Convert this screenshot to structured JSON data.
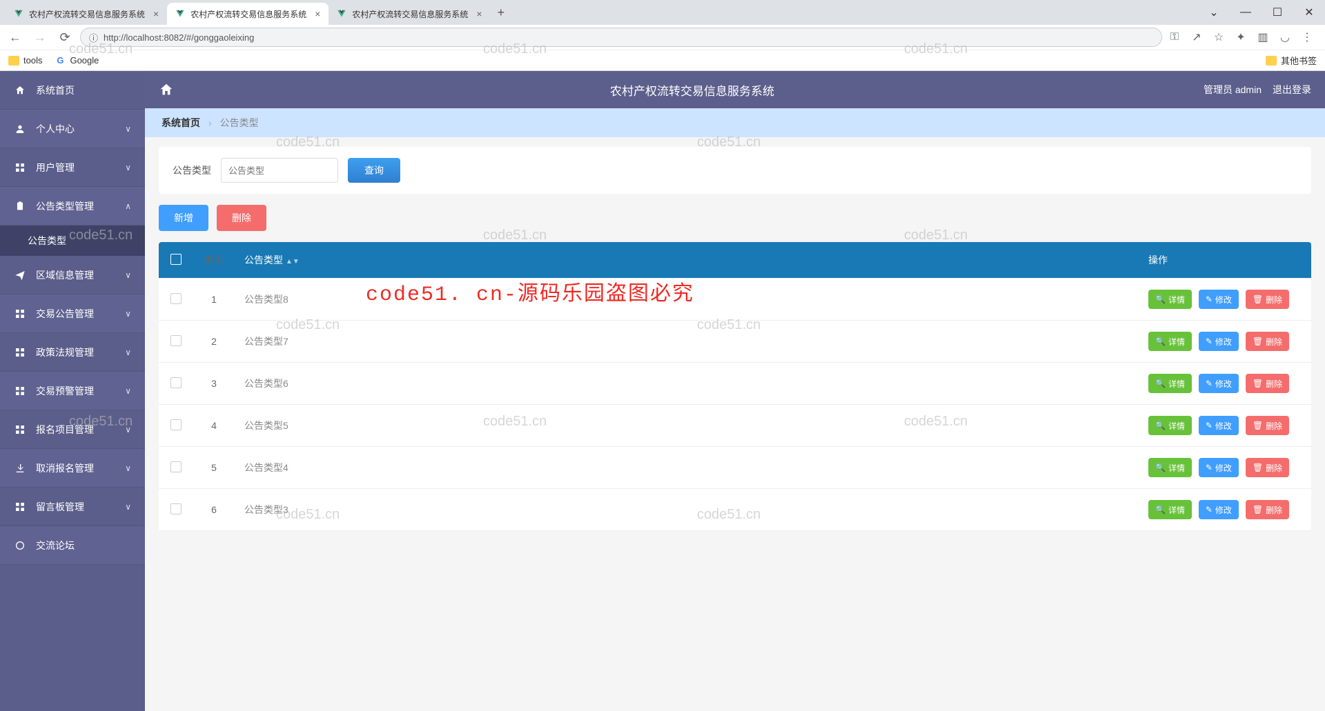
{
  "browser": {
    "tabs": [
      {
        "title": "农村产权流转交易信息服务系统",
        "active": false
      },
      {
        "title": "农村产权流转交易信息服务系统",
        "active": true
      },
      {
        "title": "农村产权流转交易信息服务系统",
        "active": false
      }
    ],
    "url": "http://localhost:8082/#/gonggaoleixing",
    "bookmarks": {
      "tools": "tools",
      "google": "Google",
      "other": "其他书签"
    }
  },
  "header": {
    "title": "农村产权流转交易信息服务系统",
    "user_label": "管理员 admin",
    "logout": "退出登录"
  },
  "sidebar": {
    "items": [
      {
        "icon": "home",
        "label": "系统首页",
        "expandable": false
      },
      {
        "icon": "user",
        "label": "个人中心",
        "expandable": true,
        "open": false
      },
      {
        "icon": "grid",
        "label": "用户管理",
        "expandable": true,
        "open": false
      },
      {
        "icon": "clipboard",
        "label": "公告类型管理",
        "expandable": true,
        "open": true,
        "sub": [
          {
            "label": "公告类型",
            "active": true
          }
        ]
      },
      {
        "icon": "send",
        "label": "区域信息管理",
        "expandable": true,
        "open": false
      },
      {
        "icon": "grid",
        "label": "交易公告管理",
        "expandable": true,
        "open": false
      },
      {
        "icon": "grid",
        "label": "政策法规管理",
        "expandable": true,
        "open": false
      },
      {
        "icon": "grid",
        "label": "交易预警管理",
        "expandable": true,
        "open": false
      },
      {
        "icon": "grid",
        "label": "报名项目管理",
        "expandable": true,
        "open": false
      },
      {
        "icon": "download",
        "label": "取消报名管理",
        "expandable": true,
        "open": false
      },
      {
        "icon": "grid",
        "label": "留言板管理",
        "expandable": true,
        "open": false
      },
      {
        "icon": "circle",
        "label": "交流论坛",
        "expandable": false
      }
    ]
  },
  "breadcrumb": {
    "home": "系统首页",
    "current": "公告类型"
  },
  "search": {
    "label": "公告类型",
    "placeholder": "公告类型",
    "query_btn": "查询"
  },
  "actions": {
    "add": "新增",
    "delete": "删除"
  },
  "table": {
    "headers": {
      "index": "索引",
      "type": "公告类型",
      "ops": "操作"
    },
    "rows": [
      {
        "index": 1,
        "type": "公告类型8"
      },
      {
        "index": 2,
        "type": "公告类型7"
      },
      {
        "index": 3,
        "type": "公告类型6"
      },
      {
        "index": 4,
        "type": "公告类型5"
      },
      {
        "index": 5,
        "type": "公告类型4"
      },
      {
        "index": 6,
        "type": "公告类型3"
      }
    ],
    "row_btns": {
      "detail": "详情",
      "edit": "修改",
      "delete": "删除"
    }
  },
  "watermarks": {
    "small": "code51.cn",
    "big": "code51. cn-源码乐园盗图必究"
  }
}
